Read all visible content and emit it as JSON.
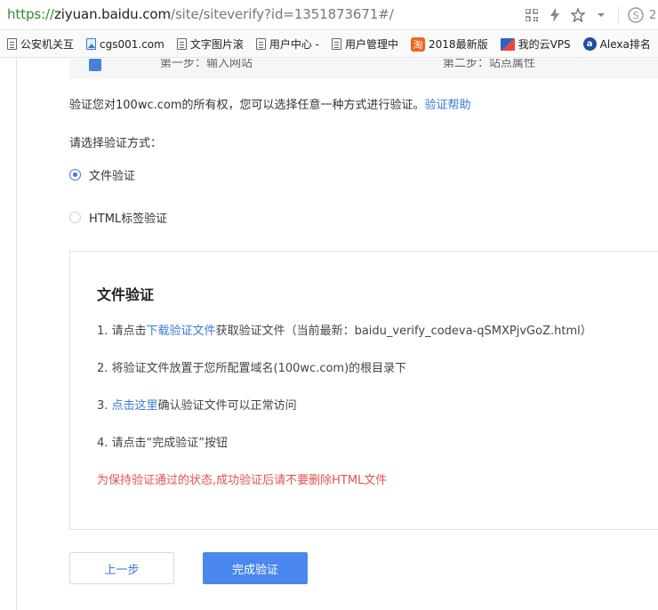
{
  "browser": {
    "url": {
      "scheme": "https://",
      "host": "ziyuan.baidu.com",
      "path": "/site/siteverify?id=1351873671#/"
    },
    "tab_count_fragment": "2"
  },
  "bookmarks": [
    {
      "label": "公安机关互",
      "icon": "page-icon"
    },
    {
      "label": "cgs001.com",
      "icon": "image-icon"
    },
    {
      "label": "文字图片滚",
      "icon": "page-icon"
    },
    {
      "label": "用户中心 -",
      "icon": "page-icon"
    },
    {
      "label": "用户管理中",
      "icon": "page-icon"
    },
    {
      "label": "2018最新版",
      "icon": "taobao-icon",
      "icon_text": "淘"
    },
    {
      "label": "我的云VPS",
      "icon": "vps-icon"
    },
    {
      "label": "Alexa排名",
      "icon": "alexa-icon",
      "icon_text": "a"
    }
  ],
  "steps_banner": {
    "step1": "第一步：输入网站",
    "step2": "第二步：站点属性"
  },
  "intro": {
    "text": "验证您对100wc.com的所有权，您可以选择任意一种方式进行验证。",
    "help_link": "验证帮助"
  },
  "choose_label": "请选择验证方式：",
  "methods": [
    {
      "label": "文件验证",
      "selected": true
    },
    {
      "label": "HTML标签验证",
      "selected": false
    }
  ],
  "panel": {
    "title": "文件验证",
    "step1_prefix": "1.  请点击",
    "step1_link": "下载验证文件",
    "step1_suffix": "获取验证文件（当前最新：baidu_verify_codeva-qSMXPjvGoZ.html）",
    "step2": "2.  将验证文件放置于您所配置域名(100wc.com)的根目录下",
    "step3_prefix": "3.  ",
    "step3_link": "点击这里",
    "step3_suffix": "确认验证文件可以正常访问",
    "step4": "4.  请点击“完成验证”按钮",
    "warning": "为保持验证通过的状态,成功验证后请不要删除HTML文件"
  },
  "buttons": {
    "prev": "上一步",
    "done": "完成验证"
  },
  "colors": {
    "link": "#3a78d9",
    "primary_button": "#4a87ee",
    "warning": "#e65050",
    "url_scheme": "#2f8f2f"
  }
}
